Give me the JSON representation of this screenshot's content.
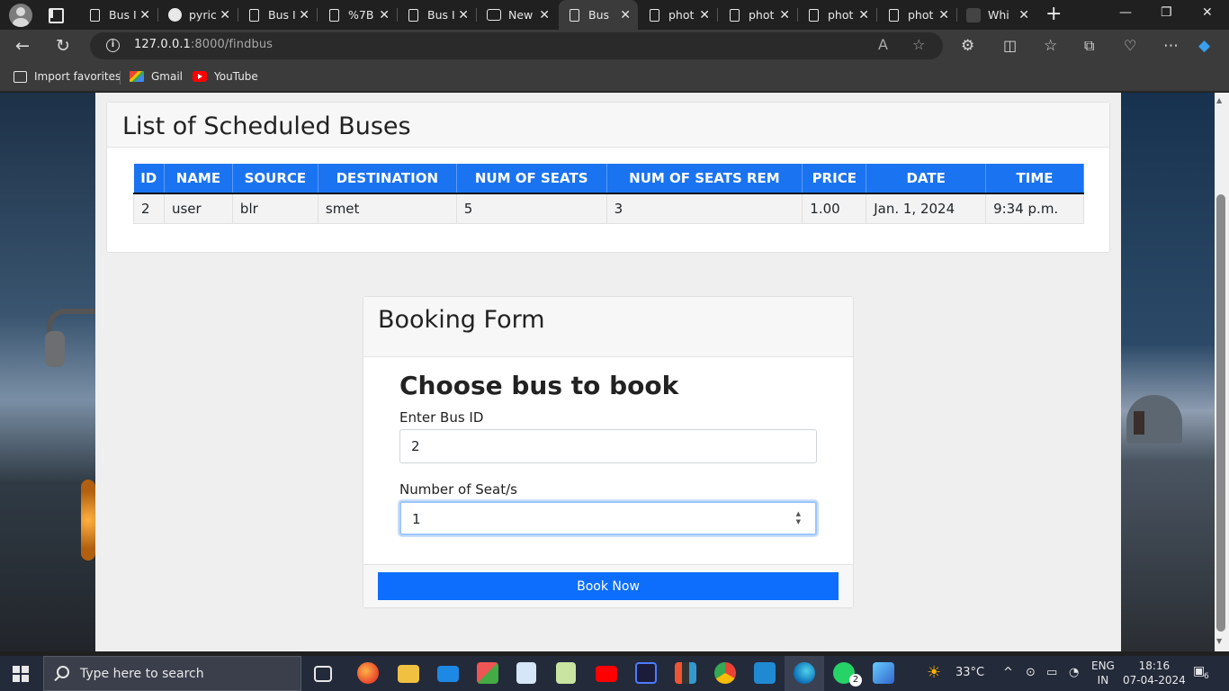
{
  "browser": {
    "tabs": [
      {
        "title": "Bus I",
        "icon": "doc-icon",
        "active": false
      },
      {
        "title": "pyric",
        "icon": "github-icon",
        "active": false
      },
      {
        "title": "Bus I",
        "icon": "doc-icon",
        "active": false
      },
      {
        "title": "%7B",
        "icon": "doc-icon",
        "active": false
      },
      {
        "title": "Bus I",
        "icon": "doc-icon",
        "active": false
      },
      {
        "title": "New",
        "icon": "new-tab-icon",
        "active": false
      },
      {
        "title": "Bus",
        "icon": "doc-icon",
        "active": true
      },
      {
        "title": "phot",
        "icon": "doc-icon",
        "active": false
      },
      {
        "title": "phot",
        "icon": "doc-icon",
        "active": false
      },
      {
        "title": "phot",
        "icon": "doc-icon",
        "active": false
      },
      {
        "title": "phot",
        "icon": "doc-icon",
        "active": false
      },
      {
        "title": "Whi",
        "icon": "site-icon",
        "active": false
      }
    ],
    "url_host": "127.0.0.1",
    "url_path": ":8000/findbus",
    "favorites": [
      {
        "label": "Import favorites",
        "icon": "import-icon"
      },
      {
        "label": "Gmail",
        "icon": "gmail-icon"
      },
      {
        "label": "YouTube",
        "icon": "youtube-icon"
      }
    ]
  },
  "schedule": {
    "title": "List of Scheduled Buses",
    "columns": [
      "ID",
      "NAME",
      "SOURCE",
      "DESTINATION",
      "NUM OF SEATS",
      "NUM OF SEATS REM",
      "PRICE",
      "DATE",
      "TIME"
    ],
    "rows": [
      [
        "2",
        "user",
        "blr",
        "smet",
        "5",
        "3",
        "1.00",
        "Jan. 1, 2024",
        "9:34 p.m."
      ]
    ]
  },
  "booking": {
    "title": "Booking Form",
    "subtitle": "Choose bus to book",
    "bus_id_label": "Enter Bus ID",
    "bus_id_value": "2",
    "seats_label": "Number of Seat/s",
    "seats_value": "1",
    "submit_label": "Book Now"
  },
  "taskbar": {
    "search_placeholder": "Type here to search",
    "weather": "33°C",
    "lang_line1": "ENG",
    "lang_line2": "IN",
    "time": "18:16",
    "date": "07-04-2024",
    "notifications": "6",
    "whatsapp_badge": "2"
  },
  "colors": {
    "accent": "#0d6efd",
    "table_header": "#1a73f0"
  }
}
